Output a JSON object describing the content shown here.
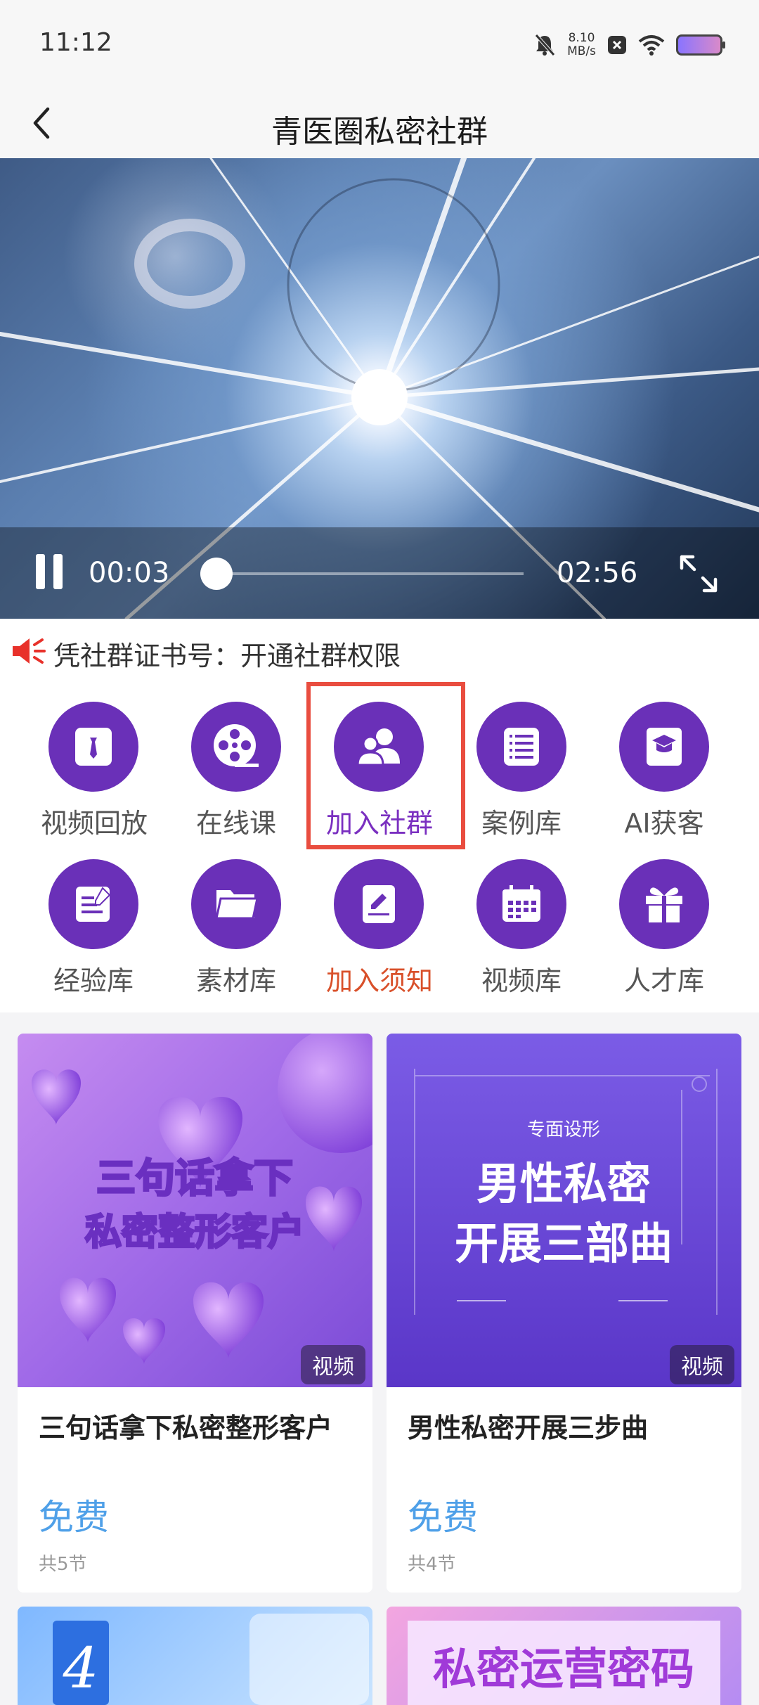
{
  "status_bar": {
    "time": "11:12",
    "net_speed_value": "8.10",
    "net_speed_unit": "MB/s"
  },
  "header": {
    "title": "青医圈私密社群"
  },
  "video": {
    "current_time": "00:03",
    "duration": "02:56",
    "progress": 0.017
  },
  "notice": {
    "text": "凭社群证书号：开通社群权限"
  },
  "grid": [
    {
      "label": "视频回放",
      "icon": "video-replay-icon"
    },
    {
      "label": "在线课",
      "icon": "film-reel-icon"
    },
    {
      "label": "加入社群",
      "icon": "group-users-icon"
    },
    {
      "label": "案例库",
      "icon": "list-document-icon"
    },
    {
      "label": "AI获客",
      "icon": "graduation-cap-icon"
    },
    {
      "label": "经验库",
      "icon": "edit-note-icon"
    },
    {
      "label": "素材库",
      "icon": "folder-icon"
    },
    {
      "label": "加入须知",
      "icon": "sign-pen-icon"
    },
    {
      "label": "视频库",
      "icon": "calendar-icon"
    },
    {
      "label": "人才库",
      "icon": "gift-icon"
    }
  ],
  "cards": [
    {
      "image_text_line1": "三句话拿下",
      "image_text_line2": "私密整形客户",
      "badge": "视频",
      "title": "三句话拿下私密整形客户",
      "price": "免费",
      "lessons": "共5节"
    },
    {
      "image_tag": "专面设形",
      "image_text_line1": "男性私密",
      "image_text_line2": "开展三部曲",
      "badge": "视频",
      "title": "男性私密开展三步曲",
      "price": "免费",
      "lessons": "共4节"
    }
  ],
  "partial_cards": [
    {
      "image_text": ""
    },
    {
      "image_text": "私密运营密码"
    }
  ],
  "colors": {
    "accent_purple": "#6a30b8",
    "highlight_red": "#e94d3f",
    "price_blue": "#4fa0e8",
    "orange": "#d9502a"
  }
}
